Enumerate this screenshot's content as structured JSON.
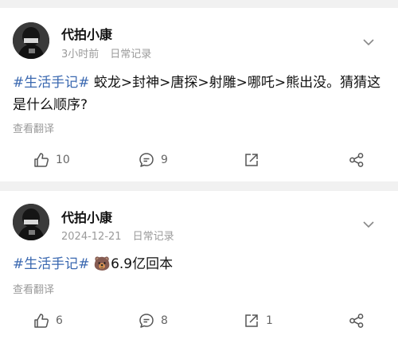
{
  "posts": [
    {
      "author": "代拍小康",
      "time": "3小时前",
      "source": "日常记录",
      "tag": "#生活手记#",
      "text": " 蛟龙>封神>唐探>射雕>哪吒>熊出没。猜猜这是什么顺序?",
      "translate": "查看翻译",
      "likes": "10",
      "comments": "9",
      "reposts": ""
    },
    {
      "author": "代拍小康",
      "time": "2024-12-21",
      "source": "日常记录",
      "tag": "#生活手记#",
      "text": " 🐻6.9亿回本",
      "translate": "查看翻译",
      "likes": "6",
      "comments": "8",
      "reposts": "1"
    }
  ],
  "icons": {
    "like": "thumbs-up-icon",
    "comment": "comment-icon",
    "repost": "repost-icon",
    "share": "share-icon",
    "more": "chevron-down-icon"
  },
  "colors": {
    "tag": "#3a68b0",
    "meta": "#9a9a9a",
    "background": "#f1f1f1"
  }
}
